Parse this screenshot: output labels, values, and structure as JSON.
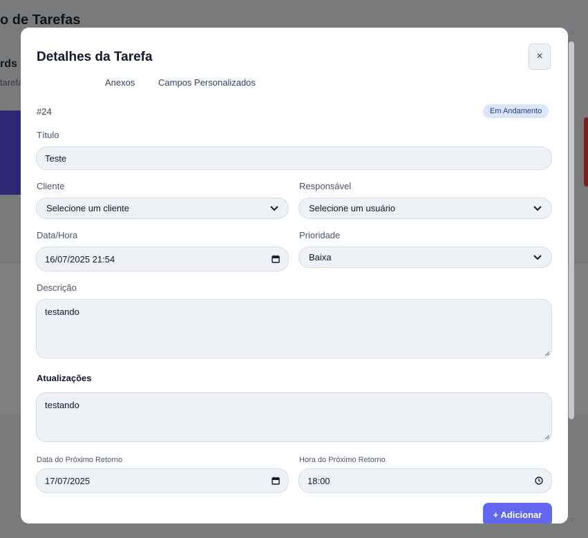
{
  "background": {
    "title_fragment": "o de Tarefas",
    "header_fragment": "rds -",
    "sub_fragment": "tarefa"
  },
  "modal": {
    "title": "Detalhes da Tarefa",
    "close_symbol": "×",
    "tabs": [
      {
        "label": "Anexos"
      },
      {
        "label": "Campos Personalizados"
      }
    ],
    "task_id": "#24",
    "status": "Em Andamento",
    "fields": {
      "titulo": {
        "label": "Título",
        "value": "Teste"
      },
      "cliente": {
        "label": "Cliente",
        "value": "Selecione um cliente"
      },
      "responsavel": {
        "label": "Responsável",
        "value": "Selecione um usuário"
      },
      "data_hora": {
        "label": "Data/Hora",
        "value": "16/07/2025 21:54"
      },
      "prioridade": {
        "label": "Prioridade",
        "value": "Baixa"
      },
      "descricao": {
        "label": "Descrição",
        "value": "testando"
      },
      "atualizacoes": {
        "label": "Atualizações",
        "value": "testando"
      },
      "data_retorno": {
        "label": "Data do Próximo Retorno",
        "value": "17/07/2025"
      },
      "hora_retorno": {
        "label": "Hora do Próximo Retorno",
        "value": "18:00"
      }
    },
    "add_button": "+ Adicionar"
  },
  "icons": {
    "select": "chevron-down-icon",
    "date": "calendar-icon",
    "time": "clock-icon",
    "close": "close-icon"
  },
  "colors": {
    "accent": "#6366f1",
    "badge_bg": "#dbe6fb",
    "badge_text": "#1e3a8a",
    "field_bg": "#eef1f6"
  }
}
